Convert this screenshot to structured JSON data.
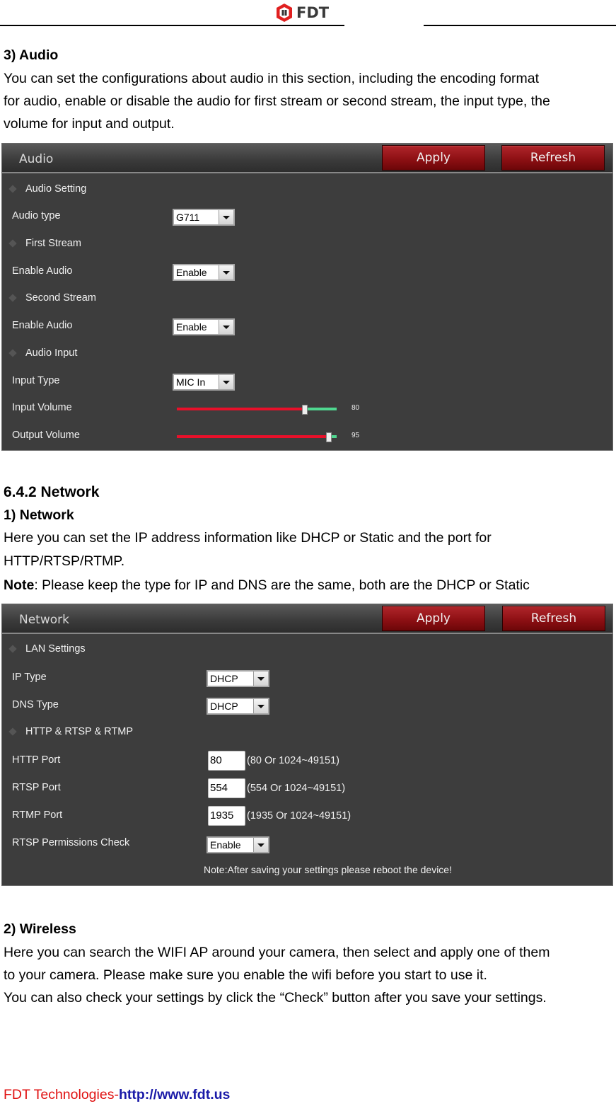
{
  "header": {
    "logo_text": "FDT",
    "logo_icon": "fdt-hexagon-logo",
    "brand_color": "#e02020"
  },
  "audio_section": {
    "heading": "3) Audio",
    "paragraph_lines": [
      "You can set the configurations about audio in this section, including the encoding format",
      "for audio, enable or disable the audio for first stream or second stream, the input type, the",
      "volume for input and output."
    ],
    "panel": {
      "title": "Audio",
      "apply_label": "Apply",
      "refresh_label": "Refresh",
      "groups": {
        "audio_setting": "Audio Setting",
        "first_stream": "First Stream",
        "second_stream": "Second Stream",
        "audio_input": "Audio Input"
      },
      "fields": {
        "audio_type": {
          "label": "Audio type",
          "value": "G711"
        },
        "first_enable_audio": {
          "label": "Enable Audio",
          "value": "Enable"
        },
        "second_enable_audio": {
          "label": "Enable Audio",
          "value": "Enable"
        },
        "input_type": {
          "label": "Input Type",
          "value": "MIC In"
        },
        "input_volume": {
          "label": "Input Volume",
          "value": "80",
          "percent": 80
        },
        "output_volume": {
          "label": "Output Volume",
          "value": "95",
          "percent": 95
        }
      }
    }
  },
  "network_section": {
    "heading": "6.4.2 Network",
    "subheading": "1) Network",
    "paragraph_lines": [
      "Here you can set the IP address information like DHCP or Static and the port for",
      "HTTP/RTSP/RTMP."
    ],
    "note_label": "Note",
    "note_text": ": Please keep the type for IP and DNS are the same, both are the DHCP or Static",
    "panel": {
      "title": "Network",
      "apply_label": "Apply",
      "refresh_label": "Refresh",
      "groups": {
        "lan_settings": "LAN Settings",
        "ports": "HTTP & RTSP & RTMP"
      },
      "fields": {
        "ip_type": {
          "label": "IP Type",
          "value": "DHCP"
        },
        "dns_type": {
          "label": "DNS Type",
          "value": "DHCP"
        },
        "http_port": {
          "label": "HTTP Port",
          "value": "80",
          "hint": "(80 Or 1024~49151)"
        },
        "rtsp_port": {
          "label": "RTSP Port",
          "value": "554",
          "hint": "(554 Or 1024~49151)"
        },
        "rtmp_port": {
          "label": "RTMP Port",
          "value": "1935",
          "hint": "(1935 Or 1024~49151)"
        },
        "rtsp_permissions": {
          "label": "RTSP Permissions Check",
          "value": "Enable"
        }
      },
      "reboot_note": "Note:After saving your settings please reboot the device!"
    }
  },
  "wireless_section": {
    "heading": "2) Wireless",
    "paragraph_lines": [
      "Here you can search the WIFI AP around your camera, then select and apply one of them",
      "to your camera. Please make sure you enable the wifi before you start to use it.",
      "You can also check your settings by click the “Check” button after you save your settings."
    ]
  },
  "footer": {
    "brand": "FDT Technologies-",
    "link": "http://www.fdt.us"
  }
}
